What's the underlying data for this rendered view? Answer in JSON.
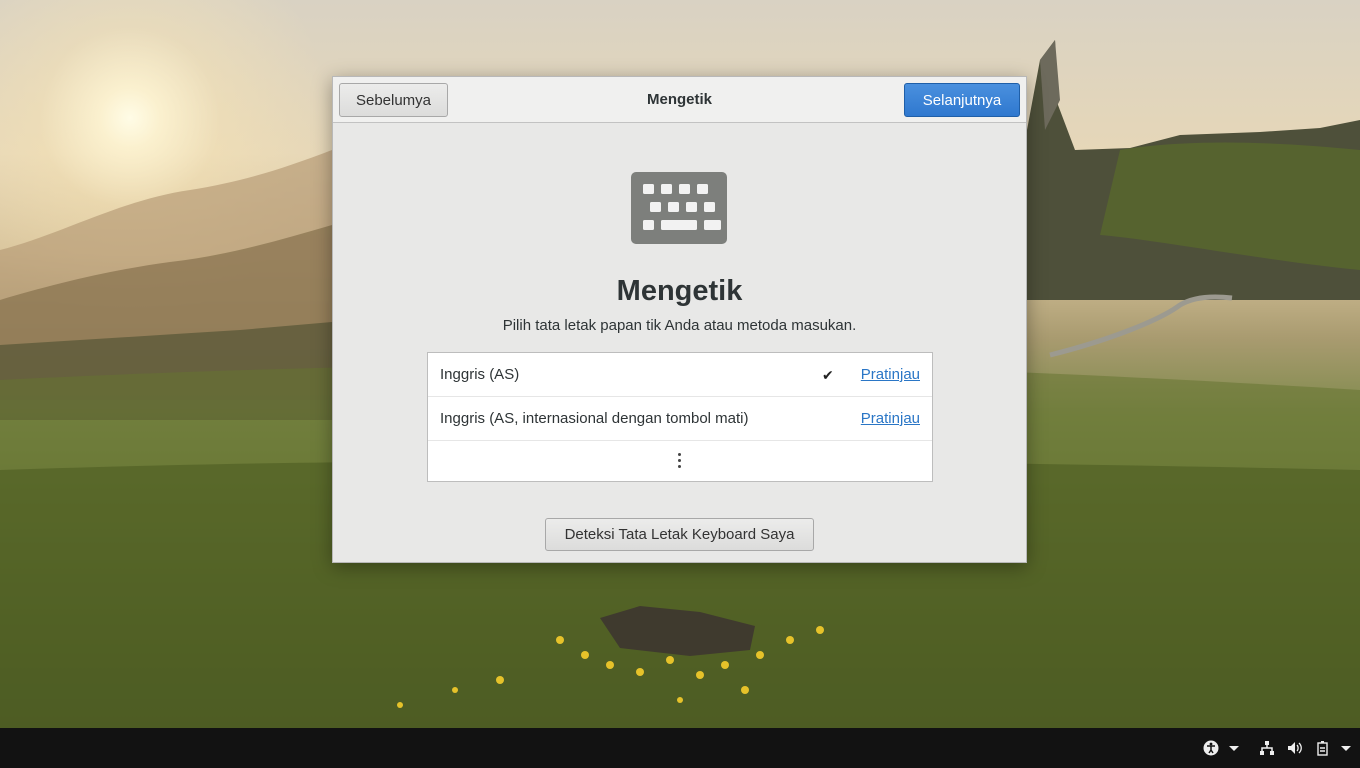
{
  "window": {
    "title": "Mengetik",
    "prev_label": "Sebelumya",
    "next_label": "Selanjutnya"
  },
  "main": {
    "icon": "keyboard-icon",
    "heading": "Mengetik",
    "subtitle": "Pilih tata letak papan tik Anda atau metoda masukan.",
    "layouts": [
      {
        "name": "Inggris (AS)",
        "selected": true,
        "preview_label": "Pratinjau"
      },
      {
        "name": "Inggris (AS, internasional dengan tombol mati)",
        "selected": false,
        "preview_label": "Pratinjau"
      }
    ],
    "more_icon": "vertical-ellipsis-icon",
    "detect_label": "Deteksi Tata Letak Keyboard Saya"
  },
  "taskbar": {
    "icons": [
      "accessibility-icon",
      "chevron-down-icon",
      "network-icon",
      "volume-icon",
      "battery-icon",
      "chevron-down-icon"
    ]
  },
  "colors": {
    "accent": "#3584e4",
    "link": "#2a76c6",
    "taskbar": "#121212"
  }
}
